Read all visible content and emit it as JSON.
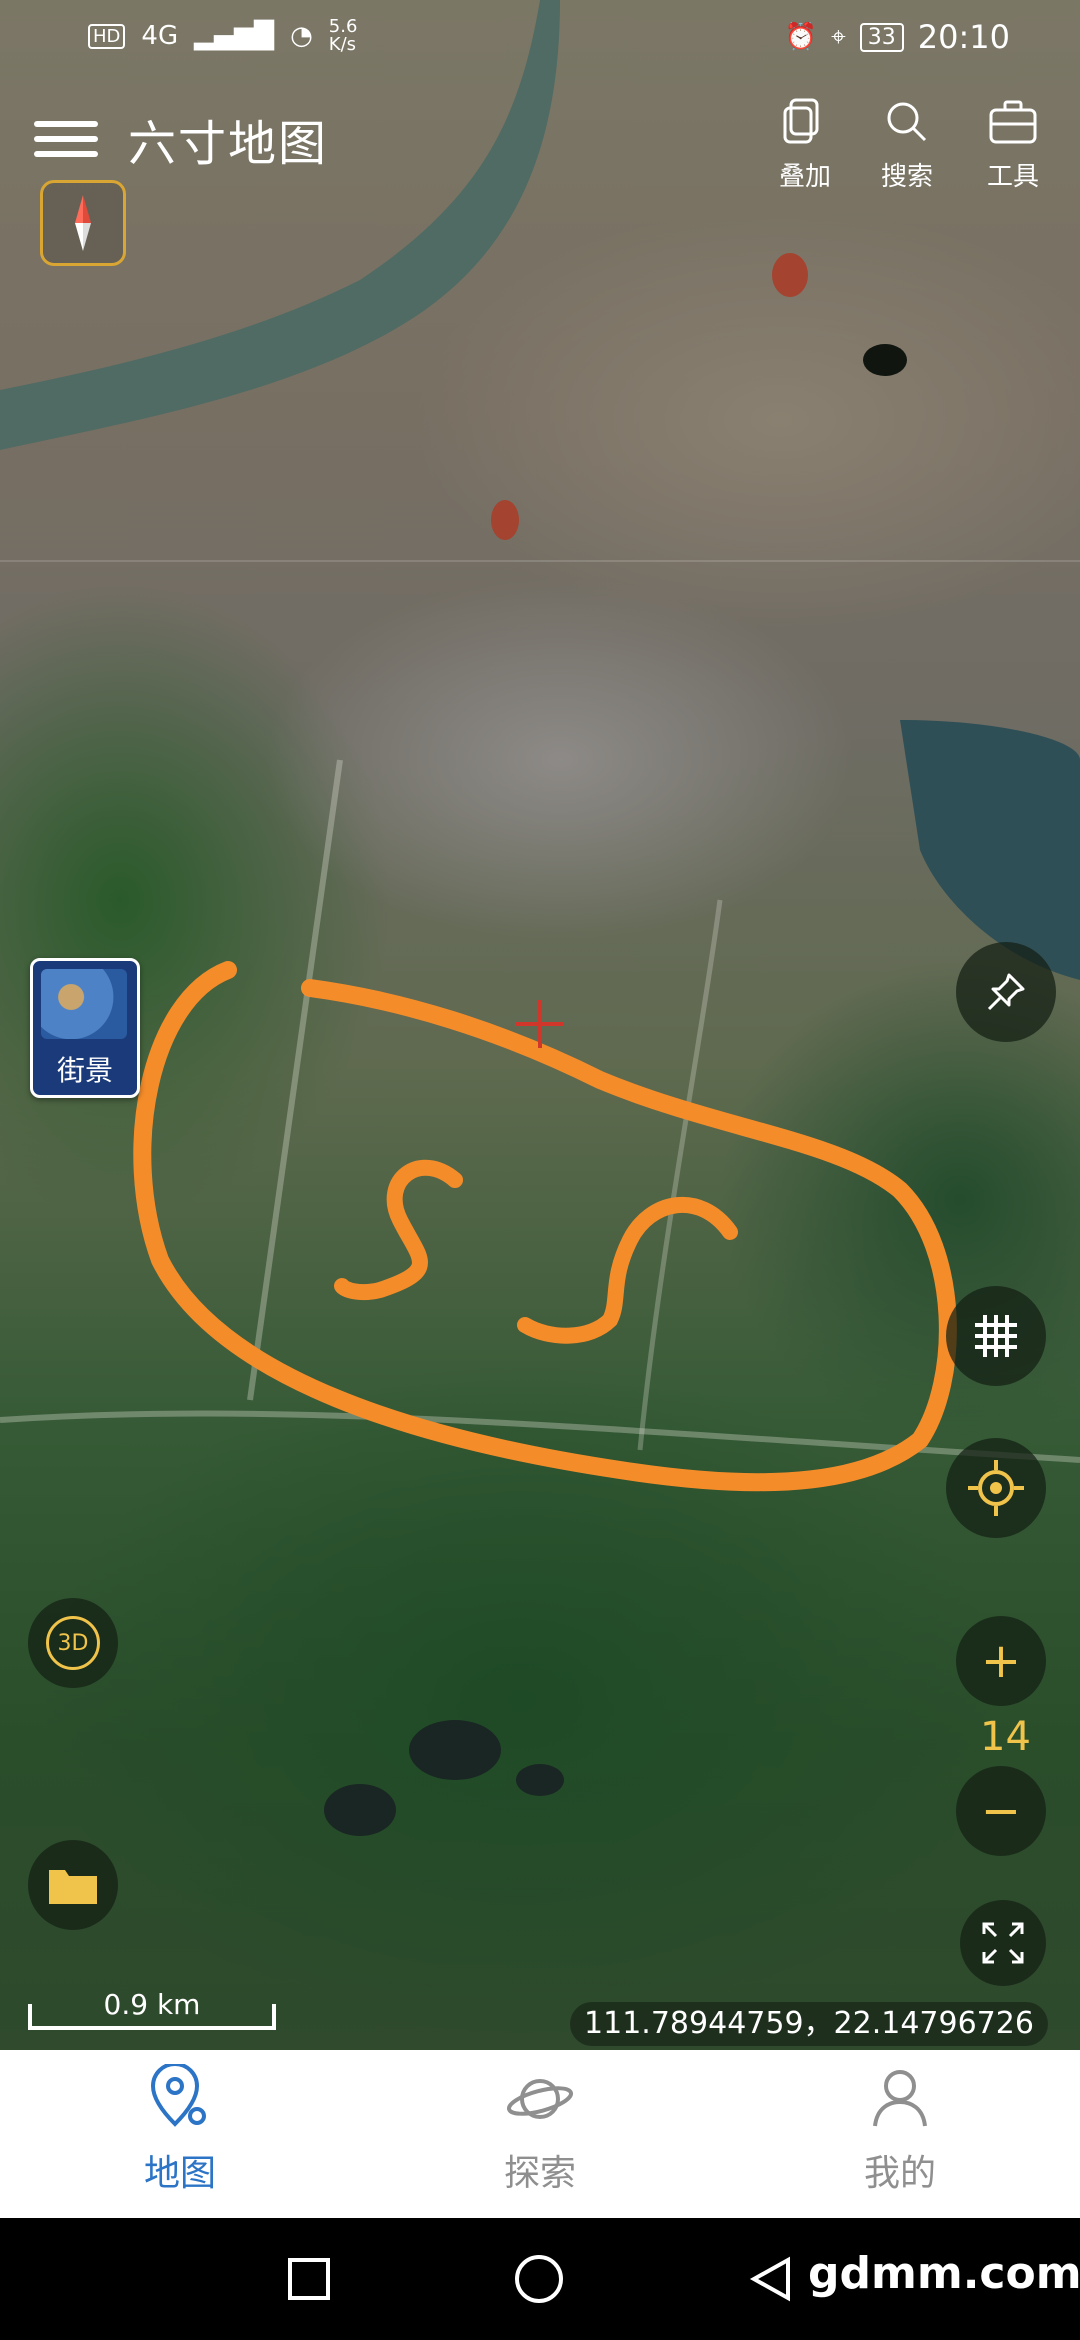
{
  "status_bar": {
    "network": "4G",
    "speed": "5.6\nK/s",
    "battery": "33",
    "time": "20:10"
  },
  "header": {
    "title": "六寸地图",
    "tools": [
      {
        "label": "叠加",
        "icon": "layers-icon"
      },
      {
        "label": "搜索",
        "icon": "search-icon"
      },
      {
        "label": "工具",
        "icon": "toolbox-icon"
      }
    ]
  },
  "map": {
    "streetview_label": "街景",
    "view_3d_label": "3D",
    "zoom_level": "14",
    "scale_label": "0.9 km",
    "coordinates": "111.78944759，22.14796726",
    "accent_color": "#f58c2a",
    "control_icon_color": "#f0c34a"
  },
  "bottom_nav": {
    "items": [
      {
        "label": "地图",
        "active": true
      },
      {
        "label": "探索",
        "active": false
      },
      {
        "label": "我的",
        "active": false
      }
    ]
  },
  "watermark": "gdmm.com"
}
